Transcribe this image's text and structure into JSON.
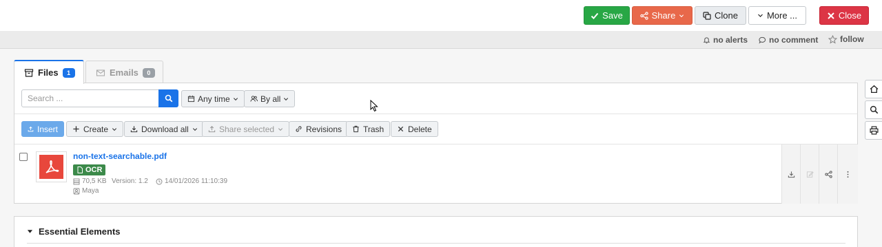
{
  "toolbar": {
    "save_label": "Save",
    "share_label": "Share",
    "clone_label": "Clone",
    "more_label": "More ...",
    "close_label": "Close"
  },
  "status": {
    "alerts": "no alerts",
    "comment": "no comment",
    "follow": "follow"
  },
  "tabs": [
    {
      "label": "Files",
      "count": "1"
    },
    {
      "label": "Emails",
      "count": "0"
    }
  ],
  "search": {
    "placeholder": "Search ...",
    "value": ""
  },
  "filters": {
    "time": "Any time",
    "by": "By all"
  },
  "actions": {
    "insert": "Insert",
    "create": "Create",
    "download_all": "Download all",
    "share_selected": "Share selected",
    "revisions": "Revisions",
    "trash": "Trash",
    "delete": "Delete"
  },
  "file": {
    "name": "non-text-searchable.pdf",
    "ocr": "OCR",
    "size": "70,5 KB",
    "version": "Version: 1.2",
    "date": "14/01/2026 11:10:39",
    "owner": "Maya"
  },
  "sections": {
    "essential": "Essential Elements"
  },
  "colors": {
    "save": "#28a745",
    "share": "#e8684a",
    "close": "#dc3545",
    "accent": "#1a73e8",
    "ocr": "#3c8a4a",
    "pdf": "#e8473c"
  }
}
